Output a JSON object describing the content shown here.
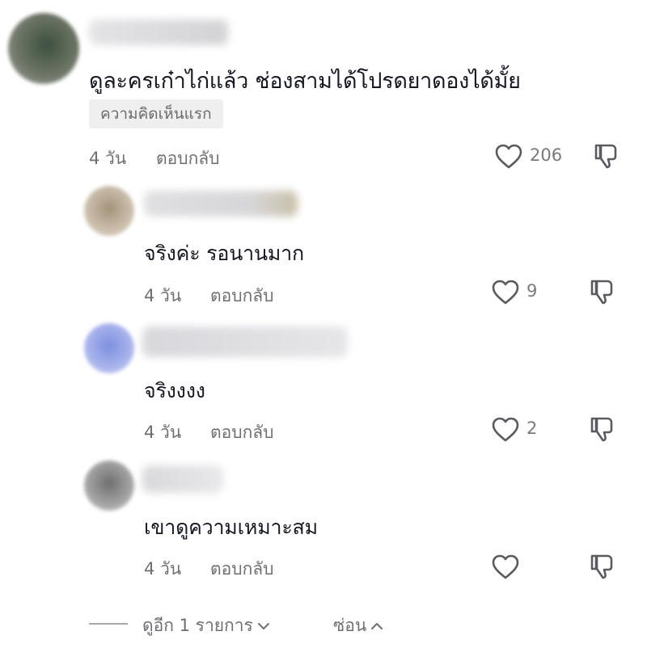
{
  "comments": [
    {
      "text": "ดูละครเก๋าไก่แล้ว ช่องสามได้โปรดยาดองได้มั้ย",
      "badge": "ความคิดเห็นแรก",
      "time": "4 วัน",
      "reply_label": "ตอบกลับ",
      "likes": "206",
      "avatar_colors": [
        "#4a5a45",
        "#8a8f85"
      ],
      "name_blur_colors": [
        "#e4e4e6",
        "#d3d3d6"
      ]
    }
  ],
  "replies": [
    {
      "text": "จริงค่ะ รอนานมาก",
      "time": "4 วัน",
      "reply_label": "ตอบกลับ",
      "likes": "9",
      "avatar_colors": [
        "#b8aa96",
        "#d9d0c4"
      ],
      "name_blur_colors": [
        "#e0e0e2",
        "#c9bfa7"
      ]
    },
    {
      "text": "จริงงงง",
      "time": "4 วัน",
      "reply_label": "ตอบกลับ",
      "likes": "2",
      "avatar_colors": [
        "#8f9fe0",
        "#c9cff2"
      ],
      "name_blur_colors": [
        "#d8d8dc",
        "#e6e6e9"
      ]
    },
    {
      "text": "เขาดูความเหมาะสม",
      "time": "4 วัน",
      "reply_label": "ตอบกลับ",
      "likes": "",
      "avatar_colors": [
        "#7f7f7f",
        "#bdbdbd"
      ],
      "name_blur_colors": [
        "#d9d9db",
        "#e8e8ea"
      ]
    }
  ],
  "footer": {
    "view_more": "ดูอีก 1 รายการ",
    "hide": "ซ่อน"
  },
  "icons": {
    "like": "heart-outline-icon",
    "dislike": "thumbs-down-outline-icon",
    "expand": "chevron-down-icon",
    "collapse": "chevron-up-icon"
  }
}
